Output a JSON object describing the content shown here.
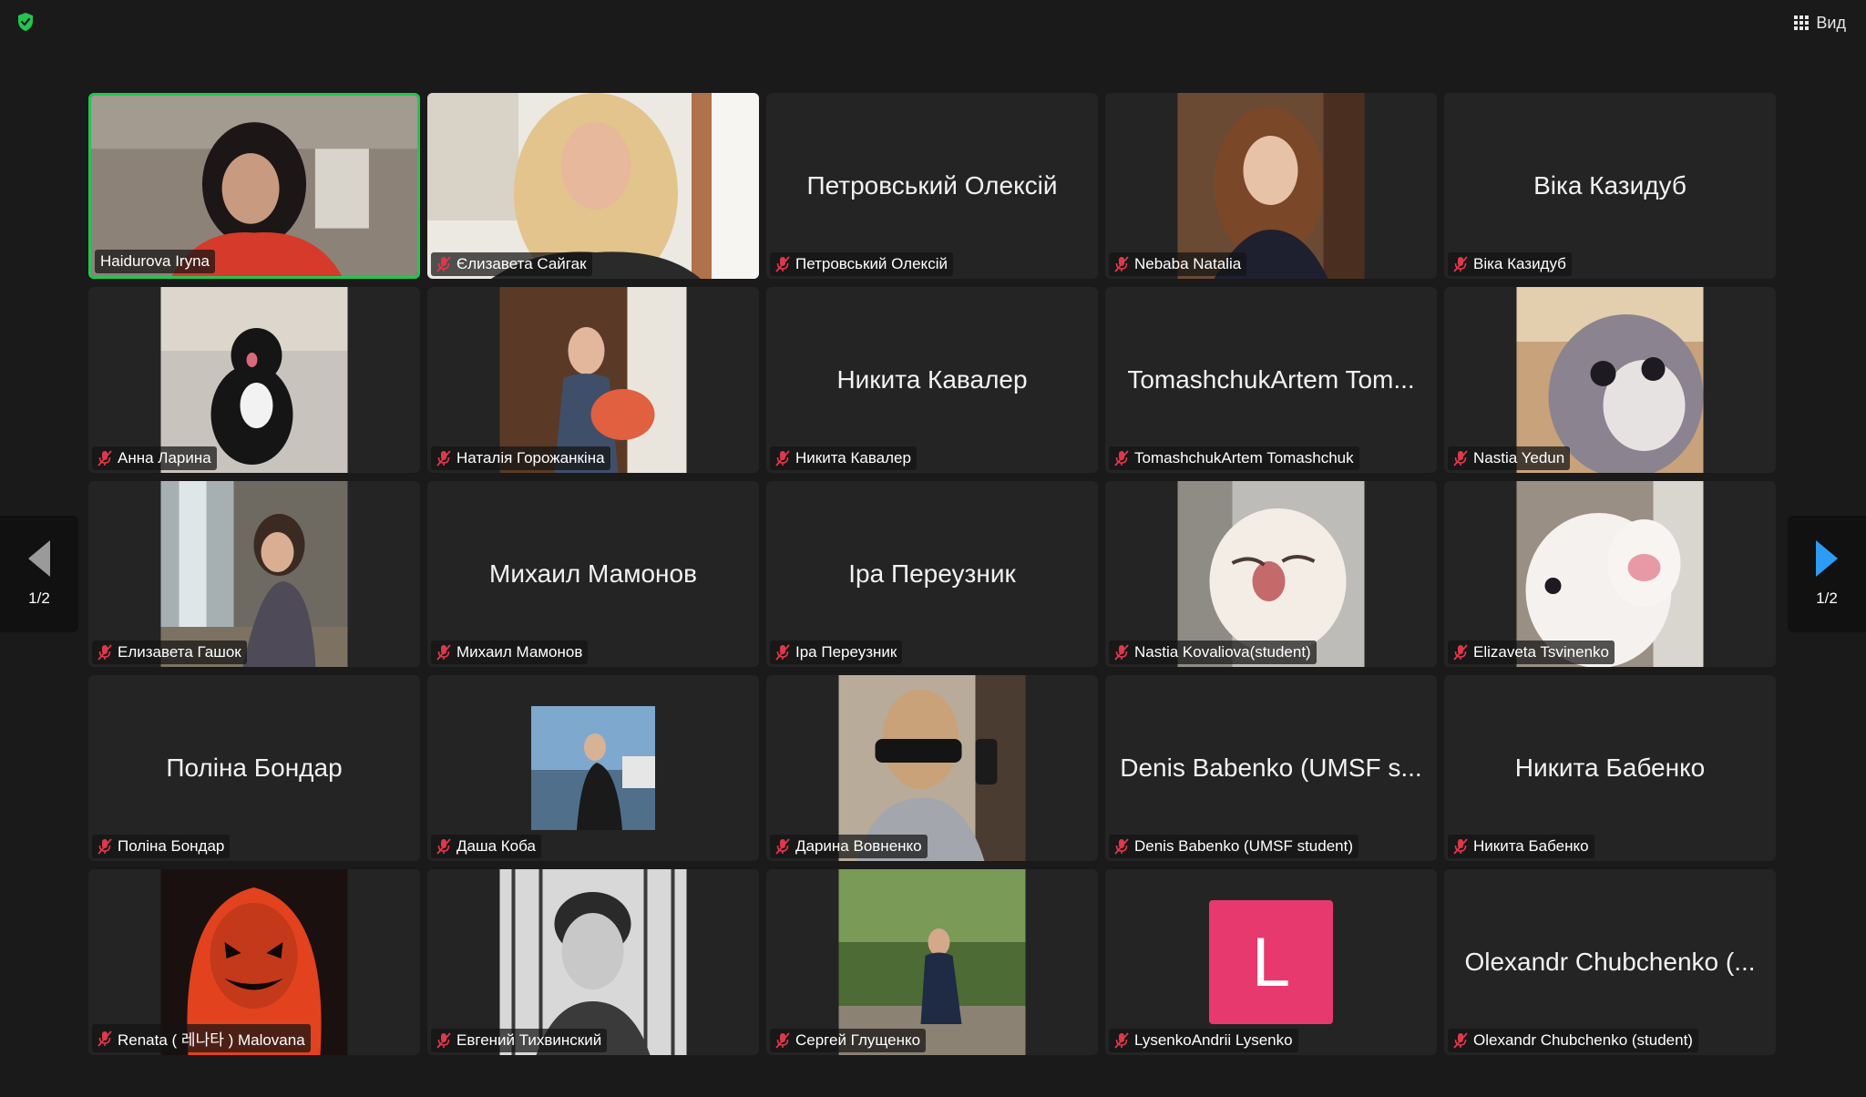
{
  "top_bar": {
    "view_label": "Вид"
  },
  "pager": {
    "left_label": "1/2",
    "right_label": "1/2"
  },
  "tiles": [
    {
      "name": "Haidurova Iryna",
      "muted": false,
      "active": true,
      "video": true
    },
    {
      "name": "Єлизавета Сайгак",
      "muted": true,
      "video": true
    },
    {
      "name": "Петровський Олексій",
      "big_name": "Петровський Олексій",
      "muted": true,
      "video": false
    },
    {
      "name": "Nebaba Natalia",
      "muted": true,
      "video": true
    },
    {
      "name": "Віка Казидуб",
      "big_name": "Віка Казидуб",
      "muted": true,
      "video": false
    },
    {
      "name": "Анна Ларина",
      "muted": true,
      "video": true
    },
    {
      "name": "Наталія Горожанкіна",
      "muted": true,
      "video": true
    },
    {
      "name": "Никита Кавалер",
      "big_name": "Никита Кавалер",
      "muted": true,
      "video": false
    },
    {
      "name": "TomashchukArtem Tomashchuk",
      "big_name": "TomashchukArtem Tom...",
      "muted": true,
      "video": false
    },
    {
      "name": "Nastia Yedun",
      "muted": true,
      "video": true
    },
    {
      "name": "Елизавета Гашок",
      "muted": true,
      "video": true
    },
    {
      "name": "Михаил Мамонов",
      "big_name": "Михаил Мамонов",
      "muted": true,
      "video": false
    },
    {
      "name": "Іра Переузник",
      "big_name": "Іра Переузник",
      "muted": true,
      "video": false
    },
    {
      "name": "Nastia Kovaliova(student)",
      "muted": true,
      "video": true
    },
    {
      "name": "Elizaveta Tsvinenko",
      "muted": true,
      "video": true
    },
    {
      "name": "Поліна Бондар",
      "big_name": "Поліна Бондар",
      "muted": true,
      "video": false
    },
    {
      "name": "Даша Коба",
      "muted": true,
      "video": true
    },
    {
      "name": "Дарина Вовненко",
      "muted": true,
      "video": true
    },
    {
      "name": "Denis Babenko (UMSF student)",
      "big_name": "Denis Babenko (UMSF s...",
      "muted": true,
      "video": false
    },
    {
      "name": "Никита Бабенко",
      "big_name": "Никита Бабенко",
      "muted": true,
      "video": false
    },
    {
      "name": "Renata ( 레나타 ) Malovana",
      "muted": true,
      "video": true
    },
    {
      "name": "Евгений Тихвинский",
      "muted": true,
      "video": true
    },
    {
      "name": "Сергей Глущенко",
      "muted": true,
      "video": true
    },
    {
      "name": "LysenkoAndrii Lysenko",
      "avatar_letter": "L",
      "muted": true,
      "video": false
    },
    {
      "name": "Olexandr Chubchenko (student)",
      "big_name": "Olexandr Chubchenko (...",
      "muted": true,
      "video": false
    }
  ]
}
